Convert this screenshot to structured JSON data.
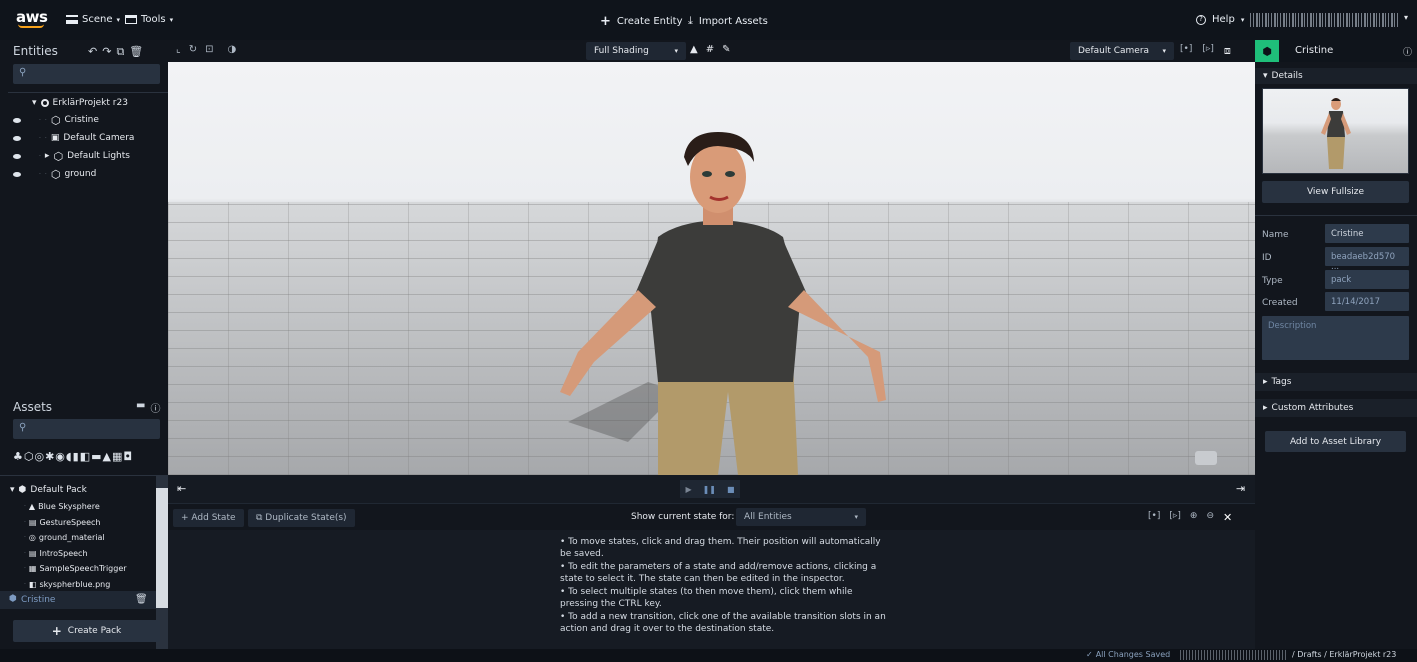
{
  "topbar": {
    "logo": "aws",
    "scene_menu": "Scene",
    "tools_menu": "Tools",
    "create_entity": "Create Entity",
    "import_assets": "Import Assets",
    "help": "Help"
  },
  "entities_panel": {
    "title": "Entities",
    "tree": {
      "root": "ErklärProjekt r23",
      "items": [
        {
          "label": "Cristine",
          "icon": "cube-outline-icon"
        },
        {
          "label": "Default Camera",
          "icon": "camera-icon"
        },
        {
          "label": "Default Lights",
          "icon": "cube-outline-icon"
        },
        {
          "label": "ground",
          "icon": "cube-outline-icon"
        }
      ]
    }
  },
  "viewport_toolbar": {
    "shading": "Full Shading",
    "camera": "Default Camera"
  },
  "assets_panel": {
    "title": "Assets",
    "pack": "Default Pack",
    "items": [
      "Blue Skysphere",
      "GestureSpeech",
      "ground_material",
      "IntroSpeech",
      "SampleSpeechTrigger",
      "skyspherblue.png"
    ],
    "selected": "Cristine",
    "create_pack": "Create Pack"
  },
  "state_machine": {
    "add_state": "Add State",
    "duplicate_state": "Duplicate State(s)",
    "show_state_label": "Show current state for:",
    "show_state_value": "All Entities",
    "instructions": [
      "To move states, click and drag them. Their position will automatically be saved.",
      "To edit the parameters of a state and add/remove actions, clicking a state to select it. The state can then be edited in the inspector.",
      "To select multiple states (to then move them), click them while pressing the CTRL key.",
      "To add a new transition, click one of the available transition slots in an action and drag it over to the destination state."
    ]
  },
  "inspector": {
    "title": "Cristine",
    "details": "Details",
    "view_fullsize": "View Fullsize",
    "fields": [
      {
        "label": "Name",
        "value": "Cristine"
      },
      {
        "label": "ID",
        "value": "beadaeb2d570 ..."
      },
      {
        "label": "Type",
        "value": "pack"
      },
      {
        "label": "Created",
        "value": "11/14/2017"
      }
    ],
    "description_placeholder": "Description",
    "tags": "Tags",
    "custom_attributes": "Custom Attributes",
    "add_to_library": "Add to Asset Library"
  },
  "statusbar": {
    "saved": "All Changes Saved",
    "breadcrumb": "/ Drafts / ErklärProjekt r23"
  },
  "colors": {
    "accent_green": "#1fbf7a",
    "panel": "#12161d",
    "field": "#2d3a4b"
  }
}
